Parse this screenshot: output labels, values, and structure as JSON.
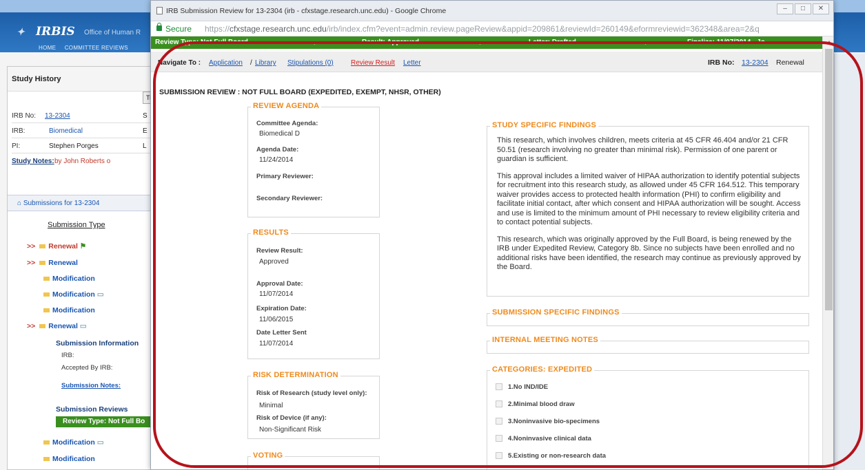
{
  "app": {
    "logo": "IRBIS",
    "logo_sub": "Office of Human R",
    "nav": [
      "HOME",
      "COMMITTEE REVIEWS"
    ],
    "study_history_title": "Study History",
    "ti_button": "Ti",
    "irb_no_label": "IRB No:",
    "irb_no_value": "13-2304",
    "irb_label": "IRB:",
    "irb_value": "Biomedical",
    "pi_label": "PI:",
    "pi_value": "Stephen Porges",
    "study_notes_label": "Study Notes:",
    "study_notes_value": "by John Roberts o",
    "col_s": "S",
    "col_e": "E",
    "col_l": "L",
    "submissions_for": "Submissions for 13-2304",
    "submission_type_header": "Submission Type",
    "submissions": [
      {
        "label": "Renewal",
        "arrow": ">>"
      },
      {
        "label": "Renewal",
        "arrow": ">>"
      },
      {
        "label": "Modification",
        "arrow": ""
      },
      {
        "label": "Modification",
        "arrow": ""
      },
      {
        "label": "Modification",
        "arrow": ""
      },
      {
        "label": "Renewal",
        "arrow": ">>"
      },
      {
        "label": "Modification",
        "arrow": ""
      },
      {
        "label": "Modification",
        "arrow": ""
      }
    ],
    "submission_information": "Submission Information",
    "si_irb": "IRB:",
    "si_accepted_by": "Accepted By IRB:",
    "si_notes": "Submission Notes:",
    "submission_reviews": "Submission Reviews",
    "review_pill": "Review Type: Not Full Bo"
  },
  "window": {
    "title": "IRB Submission Review for 13-2304 (irb - cfxstage.research.unc.edu) - Google Chrome",
    "secure": "Secure",
    "url_prefix": "https://",
    "url_host": "cfxstage.research.unc.edu",
    "url_path": "/irb/index.cfm?event=admin.review.pageReview&appid=209861&reviewId=260149&eformreviewid=362348&area=2&q",
    "buttons": {
      "minimize": "–",
      "maximize": "□",
      "close": "✕"
    }
  },
  "steps": {
    "review_type": "Review Type: Not Full Board",
    "result": "Result: Approved",
    "letter": "Letter: Drafted",
    "finalize": "Finalize: 11/07/2014 - Jo..."
  },
  "navigate": {
    "label": "Navigate To :",
    "application": "Application",
    "sep": "/",
    "library": "Library",
    "stipulations": "Stipulations (0)",
    "review_result": "Review Result",
    "letter": "Letter",
    "irb_no_label": "IRB No:",
    "irb_no_value": "13-2304",
    "irb_type": "Renewal"
  },
  "heading": "SUBMISSION REVIEW : NOT FULL BOARD (EXPEDITED, EXEMPT, NHSR, OTHER)",
  "review_agenda": {
    "legend": "REVIEW AGENDA",
    "committee_agenda_label": "Committee Agenda:",
    "committee_agenda_value": "Biomedical D",
    "agenda_date_label": "Agenda Date:",
    "agenda_date_value": "11/24/2014",
    "primary_label": "Primary Reviewer:",
    "secondary_label": "Secondary Reviewer:"
  },
  "results": {
    "legend": "RESULTS",
    "review_result_label": "Review Result:",
    "review_result_value": "Approved",
    "approval_date_label": "Approval Date:",
    "approval_date_value": "11/07/2014",
    "expiration_label": "Expiration Date:",
    "expiration_value": "11/06/2015",
    "letter_sent_label": "Date Letter Sent",
    "letter_sent_value": "11/07/2014"
  },
  "risk": {
    "legend": "RISK DETERMINATION",
    "research_label": "Risk of Research (study level only):",
    "research_value": "Minimal",
    "device_label": "Risk of Device (if any):",
    "device_value": "Non-Significant Risk"
  },
  "voting": {
    "legend": "VOTING"
  },
  "study_specific": {
    "legend": "STUDY SPECIFIC FINDINGS",
    "p1": "This research, which involves children, meets criteria at 45 CFR 46.404 and/or 21 CFR 50.51 (research involving no greater than minimal risk). Permission of one parent or guardian is sufficient.",
    "p2": "This approval includes a limited waiver of HIPAA authorization to identify potential subjects for recruitment into this research study, as allowed under 45 CFR 164.512. This temporary waiver provides access to protected health information (PHI) to confirm eligibility and facilitate initial contact, after which consent and HIPAA authorization will be sought. Access and use is limited to the minimum amount of PHI necessary to review eligibility criteria and to contact potential subjects.",
    "p3": "This research, which was originally approved by the Full Board, is being renewed by the IRB under Expedited Review, Category 8b. Since no subjects have been enrolled and no additional risks have been identified, the research may continue as previously approved by the Board."
  },
  "submission_specific": {
    "legend": "SUBMISSION SPECIFIC FINDINGS"
  },
  "internal_notes": {
    "legend": "INTERNAL MEETING NOTES"
  },
  "categories": {
    "legend": "CATEGORIES: EXPEDITED",
    "items": [
      "1.No IND/IDE",
      "2.Minimal blood draw",
      "3.Noninvasive bio-specimens",
      "4.Noninvasive clinical data",
      "5.Existing or non-research data"
    ]
  },
  "colors": {
    "accent_orange": "#ee8a1c",
    "step_green": "#3a8f1f",
    "annotation_red": "#b5131b",
    "link_blue": "#1a56b0"
  }
}
